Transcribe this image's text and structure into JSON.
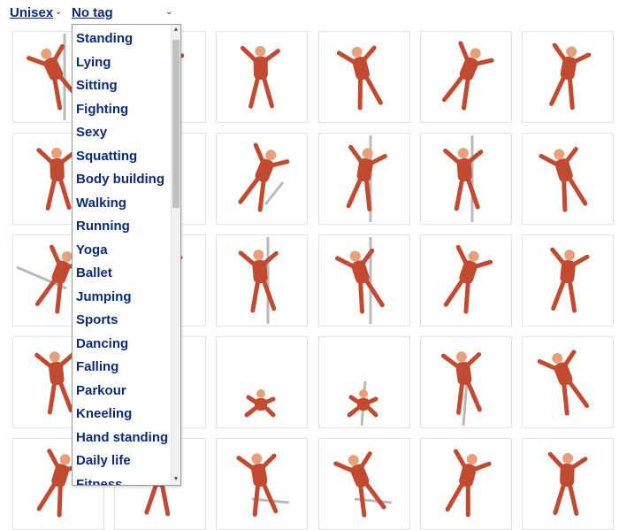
{
  "filters": {
    "gender": "Unisex",
    "tag": "No tag"
  },
  "icons": {
    "dropdown_chevron": "chevron-down-icon",
    "scroll_up": "scroll-up-arrow-icon",
    "scroll_down": "scroll-down-arrow-icon",
    "thumbnail": "muscle-anatomy-figure-icon"
  },
  "tag_options": [
    "Standing",
    "Lying",
    "Sitting",
    "Fighting",
    "Sexy",
    "Squatting",
    "Body building",
    "Walking",
    "Running",
    "Yoga",
    "Ballet",
    "Jumping",
    "Sports",
    "Dancing",
    "Falling",
    "Parkour",
    "Kneeling",
    "Hand standing",
    "Daily life",
    "Fitness"
  ],
  "colors": {
    "link": "#0c2a78",
    "muscle": "#c24a30",
    "muscle_light": "#e8a07a",
    "pole": "#b9b9b9"
  }
}
